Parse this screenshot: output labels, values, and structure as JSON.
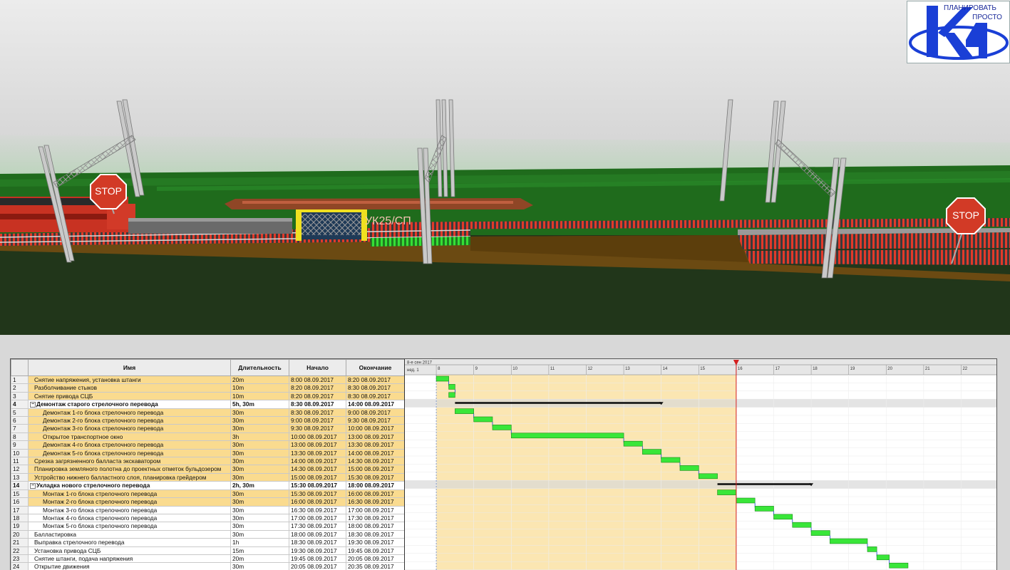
{
  "scene": {
    "stop_sign_left": "STOP",
    "stop_sign_right": "STOP",
    "machine_label": "УК25/СП"
  },
  "logo": {
    "line1": "ПЛАНИРОВАТЬ",
    "line2": "ПРОСТО",
    "mark": "K4"
  },
  "colors": {
    "done_row": "#fadb8f",
    "timeline_past": "#fbe6b2",
    "task_bar": "#39e639",
    "summary_bar": "#111111",
    "current_marker": "#d32020"
  },
  "gantt": {
    "columns": {
      "name": "Имя",
      "duration": "Длительность",
      "start": "Начало",
      "finish": "Окончание"
    },
    "timeline": {
      "date_label": "8-е сен 2017",
      "week_label": "нед. 1",
      "hours": [
        "8",
        "9",
        "10",
        "11",
        "12",
        "13",
        "14",
        "15",
        "16",
        "17",
        "18",
        "19",
        "20",
        "21",
        "22"
      ],
      "current_hour": 16.0
    },
    "tasks": [
      {
        "id": "1",
        "name": "Снятие напряжения, установка штанги",
        "duration": "20m",
        "start": "8:00 08.09.2017",
        "finish": "8:20 08.09.2017",
        "s": 8.0,
        "f": 8.333,
        "level": 1,
        "summary": false,
        "done": true
      },
      {
        "id": "2",
        "name": "Разболчивание стыков",
        "duration": "10m",
        "start": "8:20 08.09.2017",
        "finish": "8:30 08.09.2017",
        "s": 8.333,
        "f": 8.5,
        "level": 1,
        "summary": false,
        "done": true
      },
      {
        "id": "3",
        "name": "Снятие привода СЦБ",
        "duration": "10m",
        "start": "8:20 08.09.2017",
        "finish": "8:30 08.09.2017",
        "s": 8.333,
        "f": 8.5,
        "level": 1,
        "summary": false,
        "done": true
      },
      {
        "id": "4",
        "name": "Демонтаж старого стрелочного перевода",
        "duration": "5h, 30m",
        "start": "8:30 08.09.2017",
        "finish": "14:00 08.09.2017",
        "s": 8.5,
        "f": 14.0,
        "level": 0,
        "summary": true,
        "done": false
      },
      {
        "id": "5",
        "name": "Демонтаж 1-го блока стрелочного перевода",
        "duration": "30m",
        "start": "8:30 08.09.2017",
        "finish": "9:00 08.09.2017",
        "s": 8.5,
        "f": 9.0,
        "level": 2,
        "summary": false,
        "done": true
      },
      {
        "id": "6",
        "name": "Демонтаж 2-го блока стрелочного перевода",
        "duration": "30m",
        "start": "9:00 08.09.2017",
        "finish": "9:30 08.09.2017",
        "s": 9.0,
        "f": 9.5,
        "level": 2,
        "summary": false,
        "done": true
      },
      {
        "id": "7",
        "name": "Демонтаж 3-го блока стрелочного перевода",
        "duration": "30m",
        "start": "9:30 08.09.2017",
        "finish": "10:00 08.09.2017",
        "s": 9.5,
        "f": 10.0,
        "level": 2,
        "summary": false,
        "done": true
      },
      {
        "id": "8",
        "name": "Открытое транспортное окно",
        "duration": "3h",
        "start": "10:00 08.09.2017",
        "finish": "13:00 08.09.2017",
        "s": 10.0,
        "f": 13.0,
        "level": 2,
        "summary": false,
        "done": true
      },
      {
        "id": "9",
        "name": "Демонтаж 4-го блока стрелочного перевода",
        "duration": "30m",
        "start": "13:00 08.09.2017",
        "finish": "13:30 08.09.2017",
        "s": 13.0,
        "f": 13.5,
        "level": 2,
        "summary": false,
        "done": true
      },
      {
        "id": "10",
        "name": "Демонтаж 5-го блока стрелочного перевода",
        "duration": "30m",
        "start": "13:30 08.09.2017",
        "finish": "14:00 08.09.2017",
        "s": 13.5,
        "f": 14.0,
        "level": 2,
        "summary": false,
        "done": true
      },
      {
        "id": "11",
        "name": "Срезка загрязненного балласта экскаватором",
        "duration": "30m",
        "start": "14:00 08.09.2017",
        "finish": "14:30 08.09.2017",
        "s": 14.0,
        "f": 14.5,
        "level": 1,
        "summary": false,
        "done": true
      },
      {
        "id": "12",
        "name": "Планировка земляного полотна до проектных отметок бульдозером",
        "duration": "30m",
        "start": "14:30 08.09.2017",
        "finish": "15:00 08.09.2017",
        "s": 14.5,
        "f": 15.0,
        "level": 1,
        "summary": false,
        "done": true
      },
      {
        "id": "13",
        "name": "Устройство нижнего балластного слоя, планировка грейдером",
        "duration": "30m",
        "start": "15:00 08.09.2017",
        "finish": "15:30 08.09.2017",
        "s": 15.0,
        "f": 15.5,
        "level": 1,
        "summary": false,
        "done": true
      },
      {
        "id": "14",
        "name": "Укладка нового стрелочного перевода",
        "duration": "2h, 30m",
        "start": "15:30 08.09.2017",
        "finish": "18:00 08.09.2017",
        "s": 15.5,
        "f": 18.0,
        "level": 0,
        "summary": true,
        "done": false
      },
      {
        "id": "15",
        "name": "Монтаж 1-го блока стрелочного перевода",
        "duration": "30m",
        "start": "15:30 08.09.2017",
        "finish": "16:00 08.09.2017",
        "s": 15.5,
        "f": 16.0,
        "level": 2,
        "summary": false,
        "done": true
      },
      {
        "id": "16",
        "name": "Монтаж 2-го блока стрелочного перевода",
        "duration": "30m",
        "start": "16:00 08.09.2017",
        "finish": "16:30 08.09.2017",
        "s": 16.0,
        "f": 16.5,
        "level": 2,
        "summary": false,
        "done": true
      },
      {
        "id": "17",
        "name": "Монтаж 3-го блока стрелочного перевода",
        "duration": "30m",
        "start": "16:30 08.09.2017",
        "finish": "17:00 08.09.2017",
        "s": 16.5,
        "f": 17.0,
        "level": 2,
        "summary": false,
        "done": false
      },
      {
        "id": "18",
        "name": "Монтаж 4-го блока стрелочного перевода",
        "duration": "30m",
        "start": "17:00 08.09.2017",
        "finish": "17:30 08.09.2017",
        "s": 17.0,
        "f": 17.5,
        "level": 2,
        "summary": false,
        "done": false
      },
      {
        "id": "19",
        "name": "Монтаж 5-го блока стрелочного перевода",
        "duration": "30m",
        "start": "17:30 08.09.2017",
        "finish": "18:00 08.09.2017",
        "s": 17.5,
        "f": 18.0,
        "level": 2,
        "summary": false,
        "done": false
      },
      {
        "id": "20",
        "name": "Балластировка",
        "duration": "30m",
        "start": "18:00 08.09.2017",
        "finish": "18:30 08.09.2017",
        "s": 18.0,
        "f": 18.5,
        "level": 1,
        "summary": false,
        "done": false
      },
      {
        "id": "21",
        "name": "Выправка стрелочного перевода",
        "duration": "1h",
        "start": "18:30 08.09.2017",
        "finish": "19:30 08.09.2017",
        "s": 18.5,
        "f": 19.5,
        "level": 1,
        "summary": false,
        "done": false
      },
      {
        "id": "22",
        "name": "Установка привода СЦБ",
        "duration": "15m",
        "start": "19:30 08.09.2017",
        "finish": "19:45 08.09.2017",
        "s": 19.5,
        "f": 19.75,
        "level": 1,
        "summary": false,
        "done": false
      },
      {
        "id": "23",
        "name": "Снятие штанги, подача напряжения",
        "duration": "20m",
        "start": "19:45 08.09.2017",
        "finish": "20:05 08.09.2017",
        "s": 19.75,
        "f": 20.083,
        "level": 1,
        "summary": false,
        "done": false
      },
      {
        "id": "24",
        "name": "Открытие движения",
        "duration": "30m",
        "start": "20:05 08.09.2017",
        "finish": "20:35 08.09.2017",
        "s": 20.083,
        "f": 20.583,
        "level": 1,
        "summary": false,
        "done": false
      }
    ]
  }
}
